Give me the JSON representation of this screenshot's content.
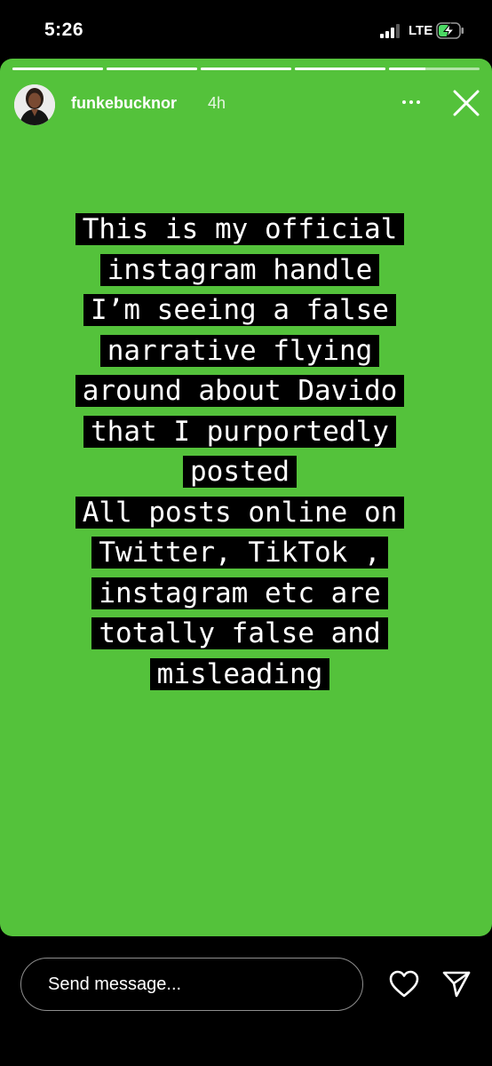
{
  "status_bar": {
    "time": "5:26",
    "network": "LTE",
    "battery_charging": true
  },
  "story": {
    "background_color": "#54c23b",
    "progress_segments": [
      1,
      1,
      1,
      1,
      0.4
    ],
    "username": "funkebucknor",
    "time_ago": "4h",
    "text_lines": [
      "This is my official",
      "instagram handle",
      "I’m seeing a false",
      "narrative flying",
      "around about Davido",
      "that I purportedly",
      "posted",
      "All posts online on",
      "Twitter, TikTok ,",
      "instagram etc are",
      "totally false and",
      "misleading"
    ]
  },
  "reply": {
    "placeholder": "Send message..."
  },
  "icons": {
    "more": "more-horizontal-icon",
    "close": "close-icon",
    "heart": "heart-icon",
    "send": "send-icon"
  }
}
